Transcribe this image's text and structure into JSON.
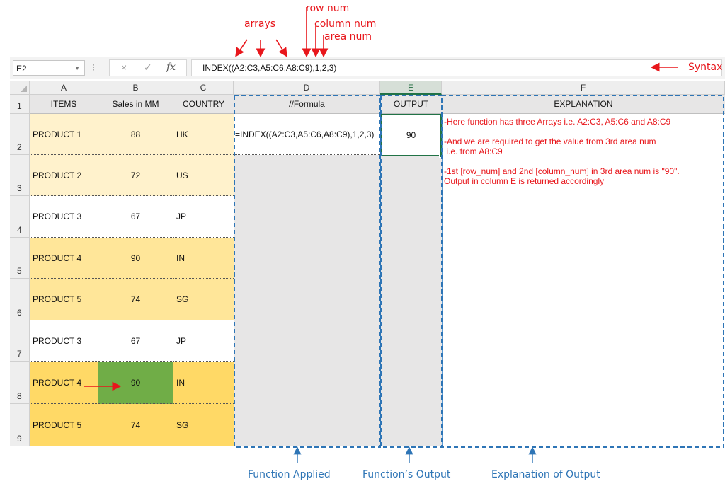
{
  "annotations": {
    "arrays": "arrays",
    "row_num": "row num",
    "column_num": "column num",
    "area_num": "area num",
    "syntax": "Syntax",
    "function_applied": "Function Applied",
    "functions_output": "Function’s Output",
    "explanation_of_output": "Explanation of Output"
  },
  "formula_bar": {
    "name_box": "E2",
    "cancel_icon": "×",
    "enter_icon": "✓",
    "fx_label": "fx",
    "formula": "=INDEX((A2:C3,A5:C6,A8:C9),1,2,3)"
  },
  "columns": [
    "A",
    "B",
    "C",
    "D",
    "E",
    "F"
  ],
  "selected_column": "E",
  "rows": [
    "1",
    "2",
    "3",
    "4",
    "5",
    "6",
    "7",
    "8",
    "9"
  ],
  "header_row": {
    "a": "ITEMS",
    "b": "Sales in MM",
    "c": "COUNTRY",
    "d": "//Formula",
    "e": "OUTPUT",
    "f": "EXPLANATION"
  },
  "data_rows": [
    {
      "item": "PRODUCT 1",
      "sales": "88",
      "country": "HK"
    },
    {
      "item": "PRODUCT 2",
      "sales": "72",
      "country": "US"
    },
    {
      "item": "PRODUCT 3",
      "sales": "67",
      "country": "JP"
    },
    {
      "item": "PRODUCT 4",
      "sales": "90",
      "country": "IN"
    },
    {
      "item": "PRODUCT 5",
      "sales": "74",
      "country": "SG"
    },
    {
      "item": "PRODUCT 3",
      "sales": "67",
      "country": "JP"
    },
    {
      "item": "PRODUCT 4",
      "sales": "90",
      "country": "IN"
    },
    {
      "item": "PRODUCT 5",
      "sales": "74",
      "country": "SG"
    }
  ],
  "d2_formula": "=INDEX((A2:C3,A5:C6,A8:C9),1,2,3)",
  "e2_output": "90",
  "explanation": "-Here function has three Arrays i.e. A2:C3, A5:C6 and A8:C9\n\n-And we are required to get the value from 3rd area num\n i.e. from A8:C9\n\n-1st [row_num] and 2nd [column_num] in 3rd area num is \"90\".\nOutput in column E is returned accordingly",
  "colors": {
    "area1": "#fff2cc",
    "area2": "#ffe699",
    "area3": "#ffd966",
    "highlight": "#70ad47",
    "annotation_red": "#e8161b",
    "annotation_blue": "#2e75b6",
    "selected_border": "#217346"
  }
}
